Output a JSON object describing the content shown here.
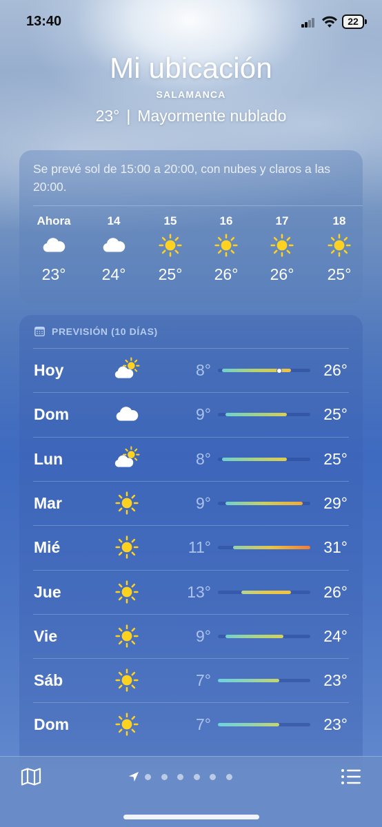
{
  "status_bar": {
    "time": "13:40",
    "battery": "22"
  },
  "header": {
    "location": "Mi ubicación",
    "city": "SALAMANCA",
    "temp": "23°",
    "separator": "|",
    "condition": "Mayormente nublado"
  },
  "hourly": {
    "summary": "Se prevé sol de 15:00 a 20:00, con nubes y claros a las 20:00.",
    "hours": [
      {
        "label": "Ahora",
        "icon": "cloud-icon",
        "temp": "23°"
      },
      {
        "label": "14",
        "icon": "cloud-icon",
        "temp": "24°"
      },
      {
        "label": "15",
        "icon": "sun-icon",
        "temp": "25°"
      },
      {
        "label": "16",
        "icon": "sun-icon",
        "temp": "26°"
      },
      {
        "label": "17",
        "icon": "sun-icon",
        "temp": "26°"
      },
      {
        "label": "18",
        "icon": "sun-icon",
        "temp": "25°"
      }
    ]
  },
  "daily": {
    "header": "PREVISIÓN (10 DÍAS)",
    "range_min": 7,
    "range_max": 31,
    "current_temp": 23,
    "days": [
      {
        "name": "Hoy",
        "icon": "partly-cloudy-icon",
        "low": "8°",
        "high": "26°",
        "low_val": 8,
        "high_val": 26,
        "colors": [
          "#6fd1d0",
          "#b8d36a",
          "#f2c242"
        ]
      },
      {
        "name": "Dom",
        "icon": "cloud-icon",
        "low": "9°",
        "high": "25°",
        "low_val": 9,
        "high_val": 25,
        "colors": [
          "#6fd1d0",
          "#9fd28a",
          "#d8cf55"
        ]
      },
      {
        "name": "Lun",
        "icon": "partly-cloudy-icon",
        "low": "8°",
        "high": "25°",
        "low_val": 8,
        "high_val": 25,
        "colors": [
          "#6fd1d0",
          "#a8d382",
          "#e2cc4e"
        ]
      },
      {
        "name": "Mar",
        "icon": "sun-icon",
        "low": "9°",
        "high": "29°",
        "low_val": 9,
        "high_val": 29,
        "colors": [
          "#6fd1d0",
          "#c9d061",
          "#f0a93a"
        ]
      },
      {
        "name": "Mié",
        "icon": "sun-icon",
        "low": "11°",
        "high": "31°",
        "low_val": 11,
        "high_val": 31,
        "colors": [
          "#90d3b0",
          "#e8c444",
          "#f07c3a"
        ]
      },
      {
        "name": "Jue",
        "icon": "sun-icon",
        "low": "13°",
        "high": "26°",
        "low_val": 13,
        "high_val": 26,
        "colors": [
          "#b5d592",
          "#e6c84a",
          "#f2c242"
        ]
      },
      {
        "name": "Vie",
        "icon": "sun-icon",
        "low": "9°",
        "high": "24°",
        "low_val": 9,
        "high_val": 24,
        "colors": [
          "#6fd1d0",
          "#a8d688",
          "#d6d05a"
        ]
      },
      {
        "name": "Sáb",
        "icon": "sun-icon",
        "low": "7°",
        "high": "23°",
        "low_val": 7,
        "high_val": 23,
        "colors": [
          "#6fd1e0",
          "#8fd4b4",
          "#c8d56c"
        ]
      },
      {
        "name": "Dom",
        "icon": "sun-icon",
        "low": "7°",
        "high": "23°",
        "low_val": 7,
        "high_val": 23,
        "colors": [
          "#6fd1e0",
          "#8fd4b4",
          "#c8d56c"
        ]
      }
    ]
  },
  "bottom_bar": {
    "map_icon": "map-icon",
    "location_icon": "location-arrow-icon",
    "page_count": 7,
    "list_icon": "list-icon"
  }
}
